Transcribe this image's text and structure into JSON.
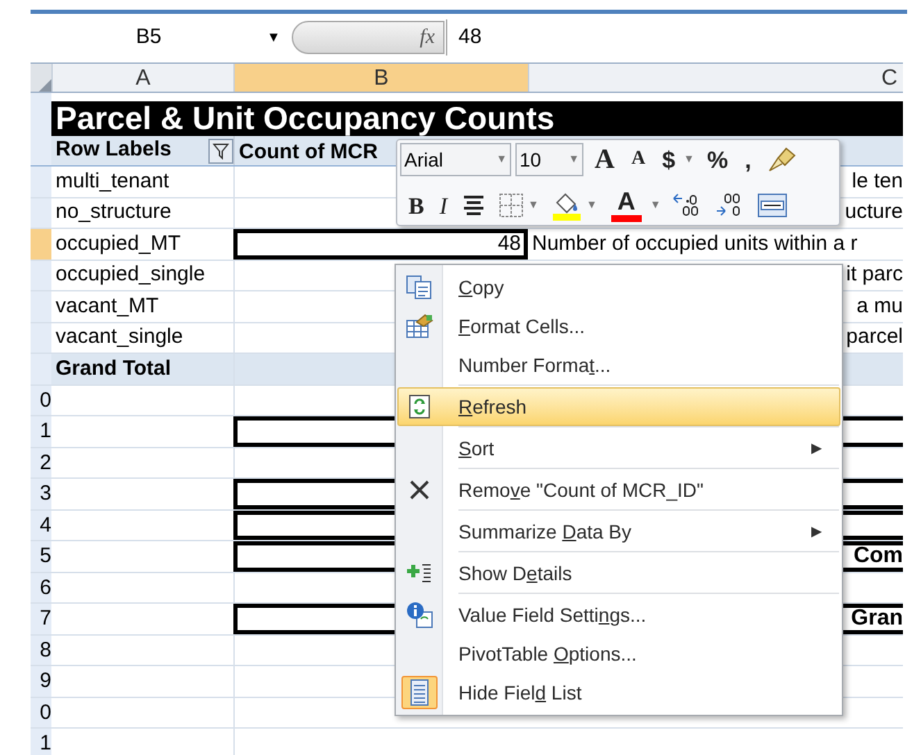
{
  "formula_bar": {
    "name_box": "B5",
    "name_box_caret": "▼",
    "function_label": "fx",
    "formula": "48"
  },
  "columns": [
    {
      "label": "A",
      "selected": false
    },
    {
      "label": "B",
      "selected": true
    },
    {
      "label": "C",
      "selected": false
    }
  ],
  "title": "Parcel & Unit Occupancy Counts",
  "pivot_header": {
    "row_labels": "Row Labels",
    "values": "Count of MCR"
  },
  "rows": [
    {
      "label": "multi_tenant",
      "c": "le ten",
      "selected": false
    },
    {
      "label": "no_structure",
      "c": "ucture",
      "selected": false
    },
    {
      "label": "occupied_MT",
      "value": "48",
      "c_left": "Number of occupied units within a r",
      "selected": true
    },
    {
      "label": "occupied_single",
      "c": "it parc",
      "selected": false
    },
    {
      "label": "vacant_MT",
      "c": "a mu",
      "selected": false
    },
    {
      "label": "vacant_single",
      "c": "parcel",
      "selected": false
    },
    {
      "label": "Grand Total",
      "kind": "total",
      "selected": false
    },
    {
      "number": "0",
      "selected": false
    },
    {
      "number": "1",
      "boxed": true,
      "selected": false
    },
    {
      "number": "2",
      "selected": false
    },
    {
      "number": "3",
      "boxed": true,
      "selected": false
    },
    {
      "number": "4",
      "boxed": true,
      "selected": false
    },
    {
      "number": "5",
      "boxed": true,
      "c": "Com",
      "c_bold": true,
      "selected": false
    },
    {
      "number": "6",
      "selected": false
    },
    {
      "number": "7",
      "boxed": true,
      "c": "Gran",
      "c_bold": true,
      "selected": false
    },
    {
      "number": "8",
      "selected": false
    },
    {
      "number": "9",
      "selected": false
    },
    {
      "number": "0",
      "selected": false
    },
    {
      "number": "1",
      "selected": false
    }
  ],
  "mini_toolbar": {
    "font": "Arial",
    "font_caret": "▼",
    "size": "10",
    "size_caret": "▼",
    "row_1": [
      {
        "kind": "glyph",
        "text": "A"
      },
      {
        "kind": "glyph",
        "text": "A"
      },
      {
        "kind": "glyph",
        "text": "$",
        "caret": "▼"
      },
      {
        "kind": "glyph",
        "text": "%"
      },
      {
        "kind": "glyph",
        "text": ","
      },
      {
        "kind": "icon"
      }
    ],
    "row_2": [
      {
        "kind": "glyph",
        "text": "B"
      },
      {
        "kind": "glyph",
        "text": "I"
      },
      {
        "kind": "icon"
      },
      {
        "kind": "icon",
        "caret": "▼"
      },
      {
        "kind": "icon",
        "color": "#ffff00",
        "caret": "▼"
      },
      {
        "kind": "glyph",
        "text": "A",
        "color": "#ff0000",
        "caret": "▼"
      },
      {
        "kind": "icon"
      },
      {
        "kind": "icon"
      },
      {
        "kind": "icon"
      }
    ]
  },
  "context_menu": [
    {
      "kind": "item",
      "key": "C",
      "after": "opy",
      "highlighted": false,
      "checked": false
    },
    {
      "kind": "item",
      "key": "F",
      "after": "ormat Cells...",
      "highlighted": false,
      "checked": false
    },
    {
      "kind": "item",
      "before": "Number Forma",
      "key": "t",
      "after": "...",
      "highlighted": false,
      "checked": false
    },
    {
      "kind": "separator"
    },
    {
      "kind": "item",
      "key": "R",
      "after": "efresh",
      "highlighted": true,
      "checked": false
    },
    {
      "kind": "separator"
    },
    {
      "kind": "item",
      "key": "S",
      "after": "ort",
      "arrow": "▶",
      "highlighted": false,
      "checked": false
    },
    {
      "kind": "separator"
    },
    {
      "kind": "item",
      "before": "Remo",
      "key": "v",
      "after": "e \"Count of MCR_ID\"",
      "highlighted": false,
      "checked": false
    },
    {
      "kind": "separator"
    },
    {
      "kind": "item",
      "before": "Summarize ",
      "key": "D",
      "after": "ata By",
      "arrow": "▶",
      "highlighted": false,
      "checked": false
    },
    {
      "kind": "separator"
    },
    {
      "kind": "item",
      "before": "Show D",
      "key": "e",
      "after": "tails",
      "highlighted": false,
      "checked": false
    },
    {
      "kind": "separator"
    },
    {
      "kind": "item",
      "before": "Value Field Setti",
      "key": "n",
      "after": "gs...",
      "highlighted": false,
      "checked": false
    },
    {
      "kind": "item",
      "before": "PivotTable ",
      "key": "O",
      "after": "ptions...",
      "highlighted": false,
      "checked": false
    },
    {
      "kind": "item",
      "before": "Hide Fiel",
      "key": "d",
      "after": " List",
      "highlighted": false,
      "checked": true
    }
  ]
}
